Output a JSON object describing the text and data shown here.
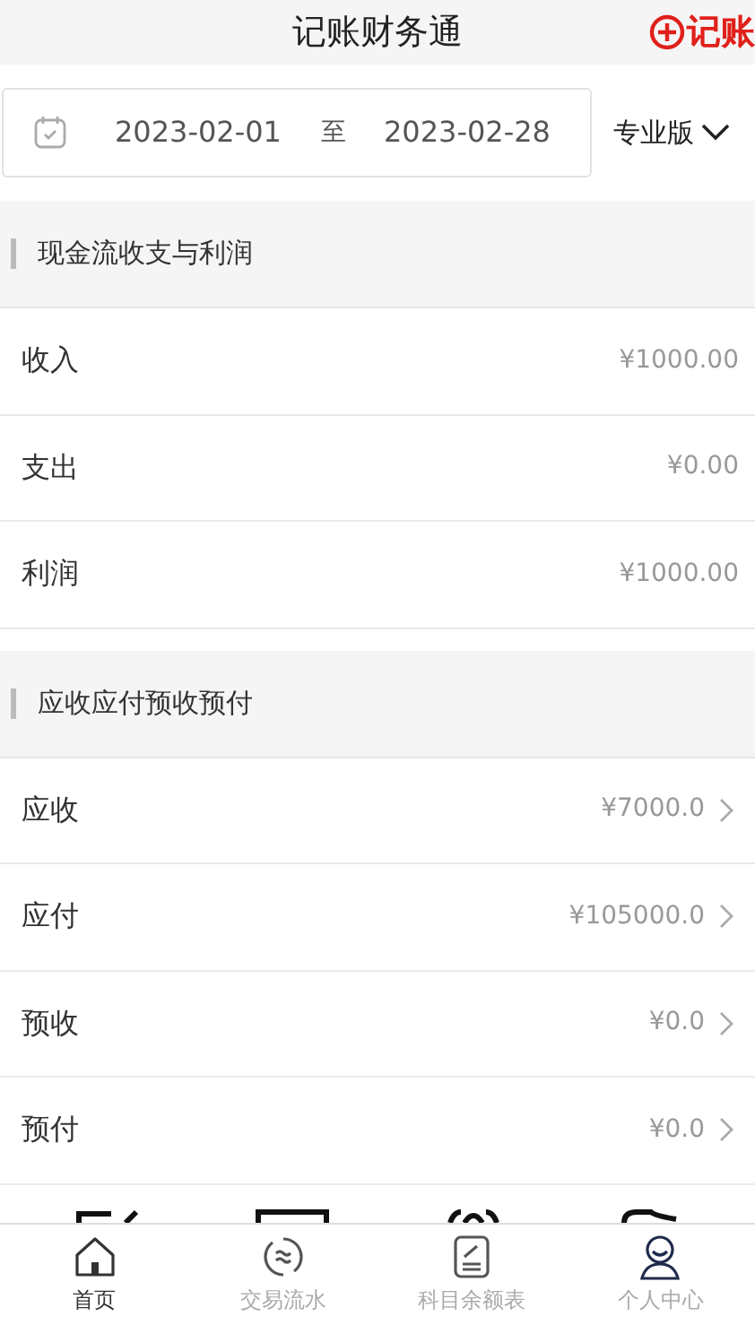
{
  "header": {
    "title": "记账财务通",
    "action": "记账"
  },
  "date_range": {
    "start": "2023-02-01",
    "separator": "至",
    "end": "2023-02-28"
  },
  "edition": "专业版",
  "sections": [
    {
      "title": "现金流收支与利润",
      "rows": [
        {
          "label": "收入",
          "value": "¥1000.00",
          "arrow": false
        },
        {
          "label": "支出",
          "value": "¥0.00",
          "arrow": false
        },
        {
          "label": "利润",
          "value": "¥1000.00",
          "arrow": false
        }
      ]
    },
    {
      "title": "应收应付预收预付",
      "rows": [
        {
          "label": "应收",
          "value": "¥7000.0",
          "arrow": true
        },
        {
          "label": "应付",
          "value": "¥105000.0",
          "arrow": true
        },
        {
          "label": "预收",
          "value": "¥0.0",
          "arrow": true
        },
        {
          "label": "预付",
          "value": "¥0.0",
          "arrow": true
        }
      ]
    }
  ],
  "tabs": [
    {
      "label": "首页",
      "kind": "home",
      "selected": true
    },
    {
      "label": "交易流水",
      "kind": "flow",
      "selected": false
    },
    {
      "label": "科目余额表",
      "kind": "ledger",
      "selected": false
    },
    {
      "label": "个人中心",
      "kind": "user",
      "selected": false
    }
  ]
}
